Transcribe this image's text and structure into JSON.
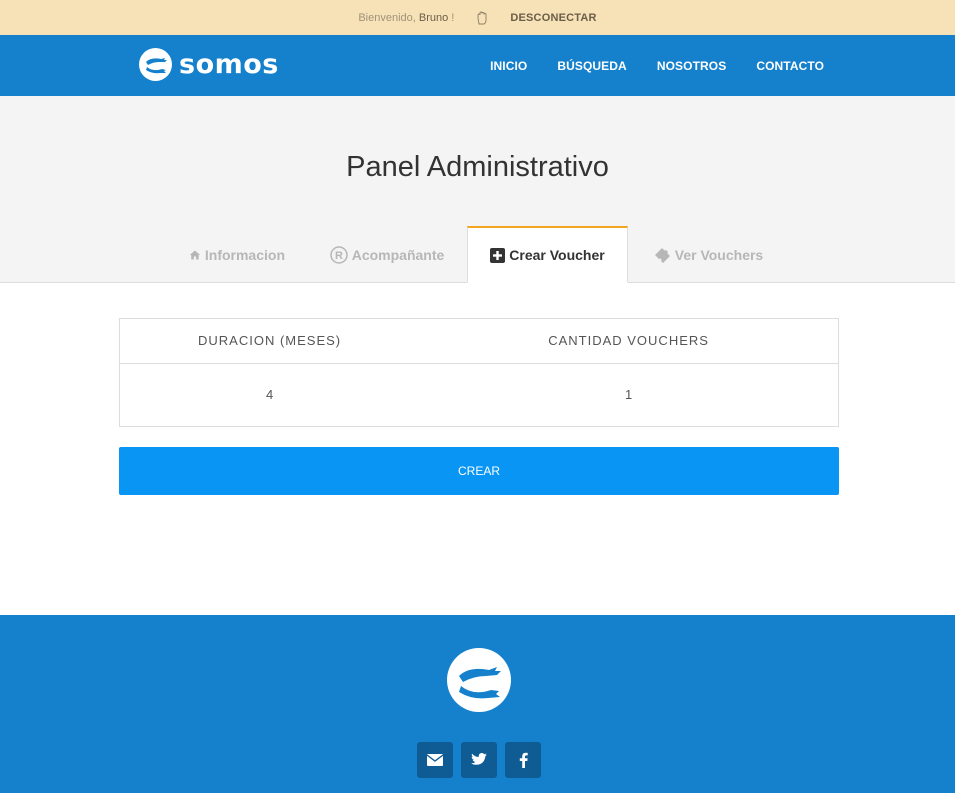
{
  "topbar": {
    "welcome_prefix": "Bienvenido, ",
    "user_name": "Bruno",
    "welcome_suffix": " !",
    "logout_label": "DESCONECTAR"
  },
  "navbar": {
    "brand_name": "somos",
    "links": [
      "INICIO",
      "BÚSQUEDA",
      "NOSOTROS",
      "CONTACTO"
    ]
  },
  "page": {
    "title": "Panel Administrativo"
  },
  "tabs": [
    {
      "label": "Informacion",
      "icon": "home-icon",
      "active": false
    },
    {
      "label": "Acompañante",
      "icon": "registered-icon",
      "active": false
    },
    {
      "label": "Crear Voucher",
      "icon": "plus-square-icon",
      "active": true
    },
    {
      "label": "Ver Vouchers",
      "icon": "ticket-icon",
      "active": false
    }
  ],
  "table": {
    "headers": [
      "DURACION (MESES)",
      "CANTIDAD VOUCHERS"
    ],
    "row": [
      "4",
      "1"
    ]
  },
  "actions": {
    "create_label": "CREAR"
  },
  "footer": {
    "social": [
      {
        "icon": "envelope-icon",
        "glyph": "✉"
      },
      {
        "icon": "twitter-icon",
        "glyph": "🐦"
      },
      {
        "icon": "facebook-icon",
        "glyph": "f"
      }
    ]
  },
  "colors": {
    "topbar_bg": "#f6e2b6",
    "primary": "#1581cd",
    "button": "#0995f4",
    "tab_accent": "#f3a720"
  }
}
